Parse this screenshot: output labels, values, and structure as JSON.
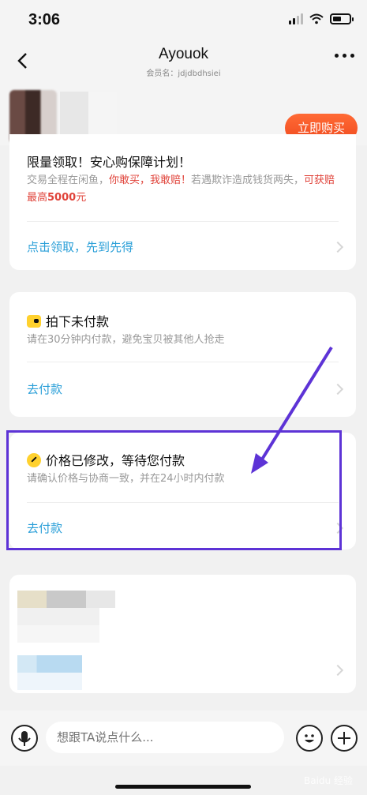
{
  "status_bar": {
    "time": "3:06"
  },
  "nav": {
    "title": "Ayouok",
    "subtitle": "会员名：jdjdbdhsiei"
  },
  "product": {
    "buy_label": "立即购买"
  },
  "guarantee_card": {
    "title": "限量领取！安心购保障计划！",
    "text_parts": [
      {
        "text": "交易全程在闲鱼，",
        "color": "#999999"
      },
      {
        "text": "你敢买，我敢赔！",
        "color": "#e0433a"
      },
      {
        "text": "若遇欺诈造成钱货两失，",
        "color": "#999999"
      },
      {
        "text": "可获赔最高",
        "color": "#e0433a"
      },
      {
        "text": "5000",
        "color": "#e0433a",
        "bold": true
      },
      {
        "text": "元",
        "color": "#e0433a"
      }
    ],
    "link": "点击领取，先到先得"
  },
  "unpaid_card": {
    "title": "拍下未付款",
    "text": "请在30分钟内付款，避免宝贝被其他人抢走",
    "link": "去付款",
    "icon": "wallet-icon"
  },
  "price_changed_card": {
    "title": "价格已修改，等待您付款",
    "text": "请确认价格与协商一致，并在24小时内付款",
    "link": "去付款",
    "icon": "clock-icon"
  },
  "input_bar": {
    "placeholder": "想跟TA说点什么...",
    "left_icon": "microphone-icon",
    "emoji_icon": "emoji-icon",
    "add_icon": "plus-icon"
  },
  "watermark": "Baidu 经验",
  "colors": {
    "accent_link": "#2a9fd8",
    "buy_button": "#f04b1f",
    "highlight": "#5d33d6",
    "warning_text": "#e0433a"
  }
}
